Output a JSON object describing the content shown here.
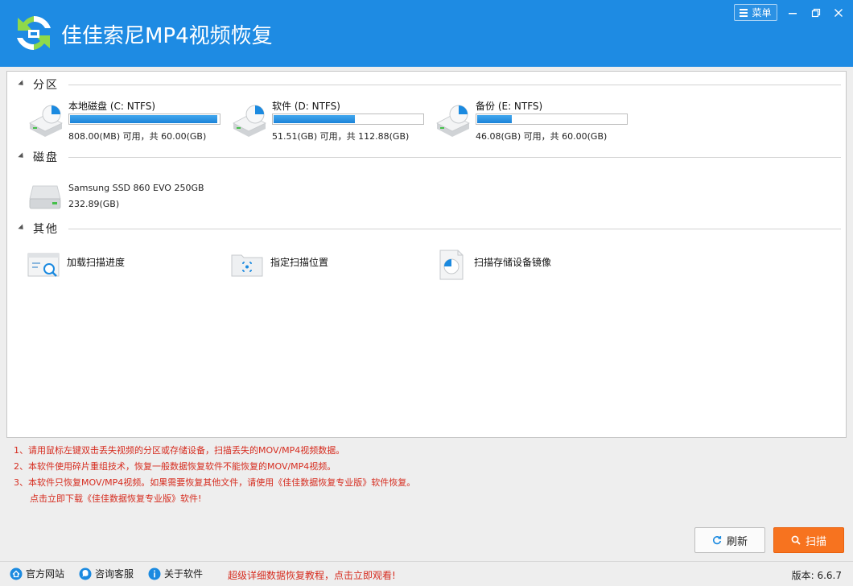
{
  "window": {
    "title": "佳佳索尼MP4视频恢复",
    "menu_label": "菜单",
    "brand_color": "#1e8be3"
  },
  "sections": {
    "partitions": {
      "label": "分区",
      "items": [
        {
          "name": "本地磁盘 (C: NTFS)",
          "info": "808.00(MB) 可用，共 60.00(GB)",
          "used_percent": 98.7,
          "icon": "hard-drive-pie-icon"
        },
        {
          "name": "软件 (D: NTFS)",
          "info": "51.51(GB) 可用，共 112.88(GB)",
          "used_percent": 54.4,
          "icon": "hard-drive-pie-icon"
        },
        {
          "name": "备份 (E: NTFS)",
          "info": "46.08(GB) 可用，共 60.00(GB)",
          "used_percent": 23.2,
          "icon": "hard-drive-pie-icon"
        }
      ]
    },
    "disks": {
      "label": "磁盘",
      "items": [
        {
          "name": "Samsung SSD 860 EVO 250GB",
          "size": "232.89(GB)",
          "icon": "ssd-disk-icon"
        }
      ]
    },
    "other": {
      "label": "其他",
      "items": [
        {
          "label": "加载扫描进度",
          "icon": "load-scan-progress-icon"
        },
        {
          "label": "指定扫描位置",
          "icon": "folder-target-icon"
        },
        {
          "label": "扫描存储设备镜像",
          "icon": "device-image-icon"
        }
      ]
    }
  },
  "notes": [
    "1、请用鼠标左键双击丢失视频的分区或存储设备，扫描丢失的MOV/MP4视频数据。",
    "2、本软件使用碎片重组技术，恢复一般数据恢复软件不能恢复的MOV/MP4视频。",
    "3、本软件只恢复MOV/MP4视频。如果需要恢复其他文件，请使用《佳佳数据恢复专业版》软件恢复。",
    "点击立即下载《佳佳数据恢复专业版》软件!"
  ],
  "actions": {
    "refresh_label": "刷新",
    "scan_label": "扫描",
    "scan_color": "#f7731f"
  },
  "statusbar": {
    "official_site": "官方网站",
    "support": "咨询客服",
    "about": "关于软件",
    "promo": "超级详细数据恢复教程，点击立即观看!",
    "version": "版本: 6.6.7"
  }
}
